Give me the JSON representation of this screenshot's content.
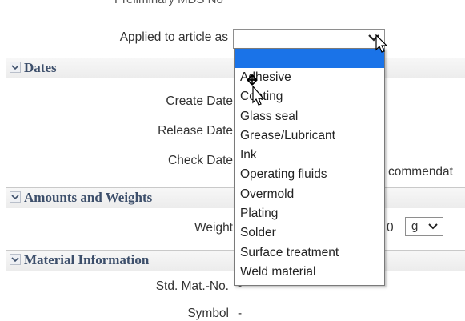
{
  "top_cut_text": "Preliminary MDS No",
  "applied_label": "Applied to article as",
  "applied_value": "",
  "sections": {
    "dates": "Dates",
    "amounts": "Amounts and Weights",
    "material": "Material Information"
  },
  "fields": {
    "create_date": "Create Date",
    "release_date": "Release Date",
    "check_date": "Check Date",
    "weight": "Weight",
    "std_mat_no": "Std. Mat.-No.",
    "symbol": "Symbol"
  },
  "values": {
    "check_date_partial": "commendat",
    "weight_value_partial": "0",
    "weight_unit": "g",
    "std_mat_no": "-",
    "symbol": "-"
  },
  "dropdown_options": [
    "Adhesive",
    "Coating",
    "Glass seal",
    "Grease/Lubricant",
    "Ink",
    "Operating fluids",
    "Overmold",
    "Plating",
    "Solder",
    "Surface treatment",
    "Weld material"
  ],
  "colors": {
    "selected_highlight": "#1a73e8",
    "section_text": "#3d4f6b"
  }
}
